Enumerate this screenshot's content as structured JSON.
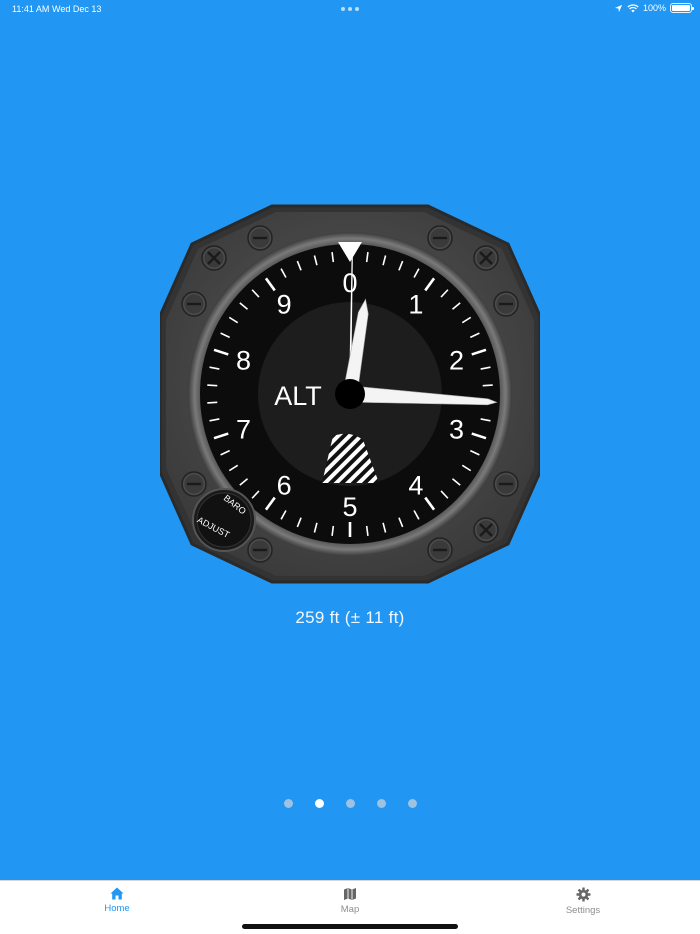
{
  "status_bar": {
    "time": "11:41 AM",
    "date": "Wed Dec 13",
    "battery": "100%"
  },
  "gauge": {
    "label": "ALT",
    "dial_numbers": [
      "0",
      "1",
      "2",
      "3",
      "4",
      "5",
      "6",
      "7",
      "8",
      "9"
    ],
    "knob_labels": [
      "BARO",
      "ADJUST"
    ],
    "altitude_ft": 259
  },
  "readout": {
    "text": "259 ft (± 11 ft)"
  },
  "pager": {
    "page_count": 5,
    "active_index": 1
  },
  "tab_bar": {
    "tabs": [
      {
        "label": "Home",
        "icon": "home-icon",
        "active": true
      },
      {
        "label": "Map",
        "icon": "map-icon",
        "active": false
      },
      {
        "label": "Settings",
        "icon": "gear-icon",
        "active": false
      }
    ]
  },
  "colors": {
    "background": "#2196F3",
    "tab_active": "#2196F3",
    "tab_inactive": "#8e8e93"
  }
}
